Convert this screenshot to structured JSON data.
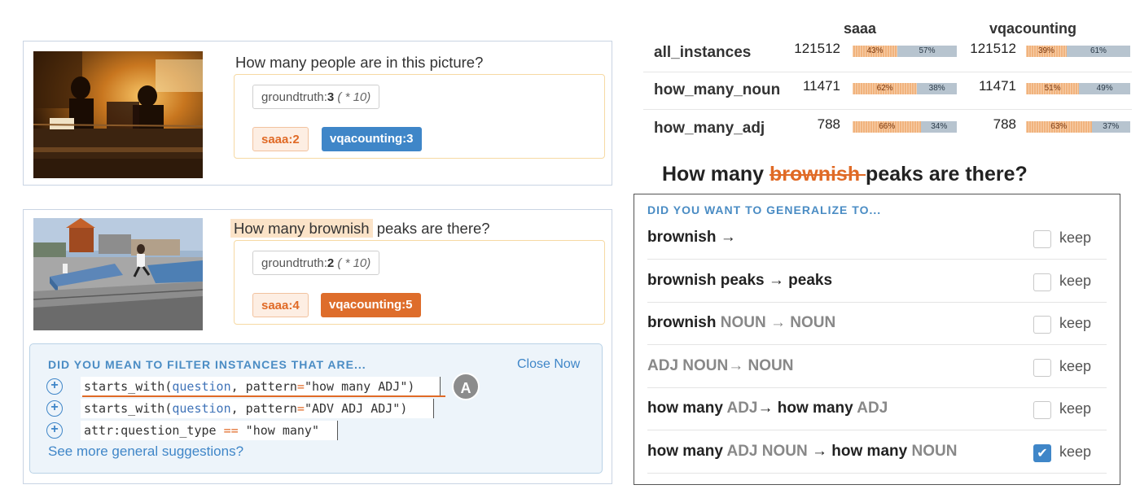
{
  "example1": {
    "question": "How many people are in this picture?",
    "groundtruth_key": "groundtruth:",
    "groundtruth_value": "3",
    "groundtruth_note": "( * 10)",
    "saaa_label": "saaa:2",
    "vqacounting_label": "vqacounting:3"
  },
  "example2": {
    "question_highlight": "How many brownish",
    "question_rest": " peaks are there?",
    "groundtruth_key": "groundtruth:",
    "groundtruth_value": "2",
    "groundtruth_note": "( * 10)",
    "saaa_label": "saaa:4",
    "vqacounting_label": "vqacounting:5"
  },
  "filter_panel": {
    "title": "DID YOU MEAN TO FILTER INSTANCES THAT ARE...",
    "close_label": "Close Now",
    "suggestions": [
      {
        "fn": "starts_with(",
        "arg": "question",
        "sep": ", pattern",
        "eq": "=",
        "value": "\"how many ADJ\")"
      },
      {
        "fn": "starts_with(",
        "arg": "question",
        "sep": ", pattern",
        "eq": "=",
        "value": "\"ADV ADJ ADJ\")"
      },
      {
        "fn": "attr:question_type ",
        "eq": "==",
        "value": " \"how many\""
      }
    ],
    "marker": "A",
    "more_link": "See more general suggestions?"
  },
  "stats": {
    "models": [
      "saaa",
      "vqacounting"
    ],
    "rows": [
      {
        "label": "all_instances",
        "saaa": {
          "count": "121512",
          "a": 43,
          "b": 57
        },
        "vqa": {
          "count": "121512",
          "a": 39,
          "b": 61
        }
      },
      {
        "label": "how_many_noun",
        "saaa": {
          "count": "11471",
          "a": 62,
          "b": 38
        },
        "vqa": {
          "count": "11471",
          "a": 51,
          "b": 49
        }
      },
      {
        "label": "how_many_adj",
        "saaa": {
          "count": "788",
          "a": 66,
          "b": 34
        },
        "vqa": {
          "count": "788",
          "a": 63,
          "b": 37
        }
      }
    ]
  },
  "rewrite": {
    "before": "How many ",
    "struck": "brownish ",
    "after": "peaks are there?"
  },
  "generalize_panel": {
    "title": "DID YOU WANT TO GENERALIZE TO...",
    "keep_label": "keep",
    "rows": [
      {
        "parts": [
          {
            "t": "brownish →",
            "pos": false
          }
        ],
        "grey": false,
        "checked": false
      },
      {
        "parts": [
          {
            "t": "brownish peaks → peaks",
            "pos": false
          }
        ],
        "grey": false,
        "checked": false
      },
      {
        "parts": [
          {
            "t": "brownish ",
            "pos": false
          },
          {
            "t": "NOUN → NOUN",
            "pos": true
          }
        ],
        "grey": false,
        "checked": false
      },
      {
        "parts": [
          {
            "t": "ADJ NOUN→ NOUN",
            "pos": false
          }
        ],
        "grey": true,
        "checked": false
      },
      {
        "parts": [
          {
            "t": "how many ",
            "pos": false
          },
          {
            "t": "ADJ",
            "pos": true
          },
          {
            "t": "→ how many ",
            "pos": false
          },
          {
            "t": "ADJ",
            "pos": true
          }
        ],
        "grey": false,
        "checked": false
      },
      {
        "parts": [
          {
            "t": "how many ",
            "pos": false
          },
          {
            "t": "ADJ NOUN",
            "pos": true
          },
          {
            "t": " → how many ",
            "pos": false
          },
          {
            "t": "NOUN",
            "pos": true
          }
        ],
        "grey": false,
        "checked": true
      }
    ]
  },
  "colors": {
    "accent_blue": "#3f86c8",
    "accent_orange": "#e06a26",
    "bar_a": "#f1b37d",
    "bar_b": "#b7c4cf"
  }
}
